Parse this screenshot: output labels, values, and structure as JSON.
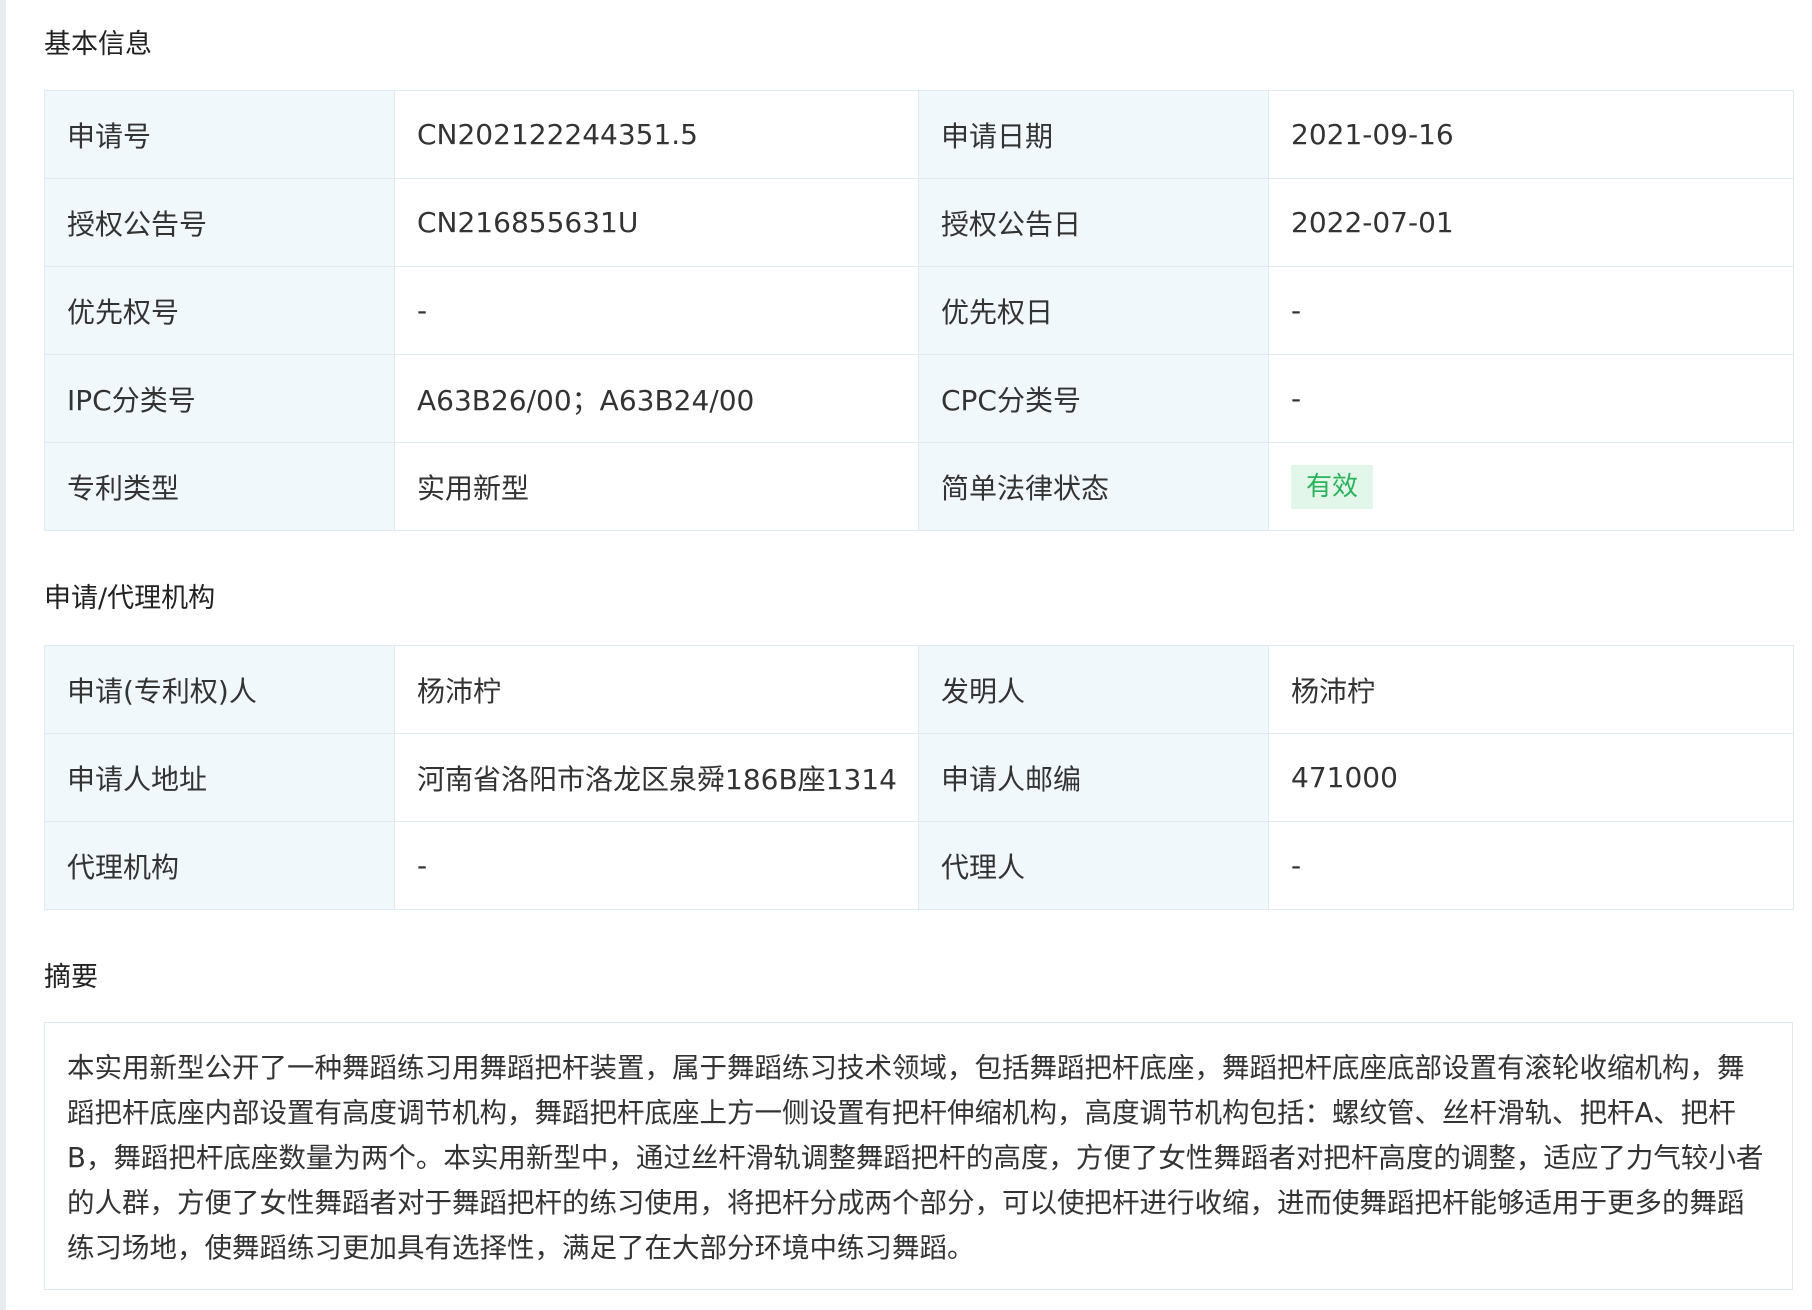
{
  "sections": {
    "basic_title": "基本信息",
    "agency_title": "申请/代理机构",
    "abstract_title": "摘要"
  },
  "basic": [
    {
      "label1": "申请号",
      "value1": "CN202122244351.5",
      "label2": "申请日期",
      "value2": "2021-09-16"
    },
    {
      "label1": "授权公告号",
      "value1": "CN216855631U",
      "label2": "授权公告日",
      "value2": "2022-07-01"
    },
    {
      "label1": "优先权号",
      "value1": "-",
      "label2": "优先权日",
      "value2": "-"
    },
    {
      "label1": "IPC分类号",
      "value1": "A63B26/00；A63B24/00",
      "label2": "CPC分类号",
      "value2": "-"
    },
    {
      "label1": "专利类型",
      "value1": "实用新型",
      "label2": "简单法律状态",
      "value2": "有效"
    }
  ],
  "status_color": "#2bb35a",
  "status_bg": "#e3f6ea",
  "agency": [
    {
      "label1": "申请(专利权)人",
      "value1": "杨沛柠",
      "label2": "发明人",
      "value2": "杨沛柠"
    },
    {
      "label1": "申请人地址",
      "value1": "河南省洛阳市洛龙区泉舜186B座1314",
      "label2": "申请人邮编",
      "value2": "471000"
    },
    {
      "label1": "代理机构",
      "value1": "-",
      "label2": "代理人",
      "value2": "-"
    }
  ],
  "abstract": "本实用新型公开了一种舞蹈练习用舞蹈把杆装置，属于舞蹈练习技术领域，包括舞蹈把杆底座，舞蹈把杆底座底部设置有滚轮收缩机构，舞蹈把杆底座内部设置有高度调节机构，舞蹈把杆底座上方一侧设置有把杆伸缩机构，高度调节机构包括：螺纹管、丝杆滑轨、把杆A、把杆B，舞蹈把杆底座数量为两个。本实用新型中，通过丝杆滑轨调整舞蹈把杆的高度，方便了女性舞蹈者对把杆高度的调整，适应了力气较小者的人群，方便了女性舞蹈者对于舞蹈把杆的练习使用，将把杆分成两个部分，可以使把杆进行收缩，进而使舞蹈把杆能够适用于更多的舞蹈练习场地，使舞蹈练习更加具有选择性，满足了在大部分环境中练习舞蹈。"
}
